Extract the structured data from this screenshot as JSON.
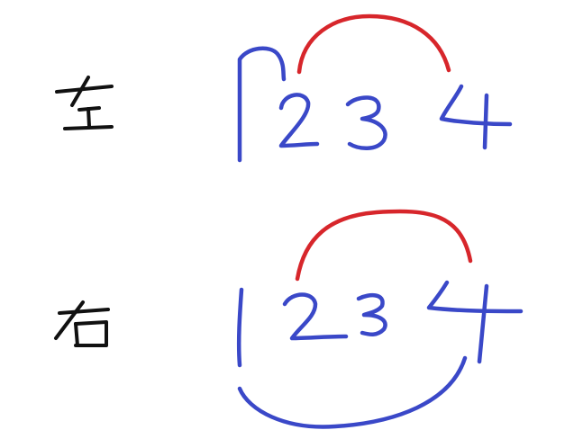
{
  "rows": [
    {
      "label": "左",
      "digits": [
        "1",
        "2",
        "3",
        "4"
      ]
    },
    {
      "label": "右",
      "digits": [
        "1",
        "2",
        "3",
        "4"
      ]
    }
  ],
  "colors": {
    "background": "#ffffff",
    "label_ink": "#111111",
    "digit_ink": "#3a48c8",
    "arc_ink": "#d7262b"
  }
}
